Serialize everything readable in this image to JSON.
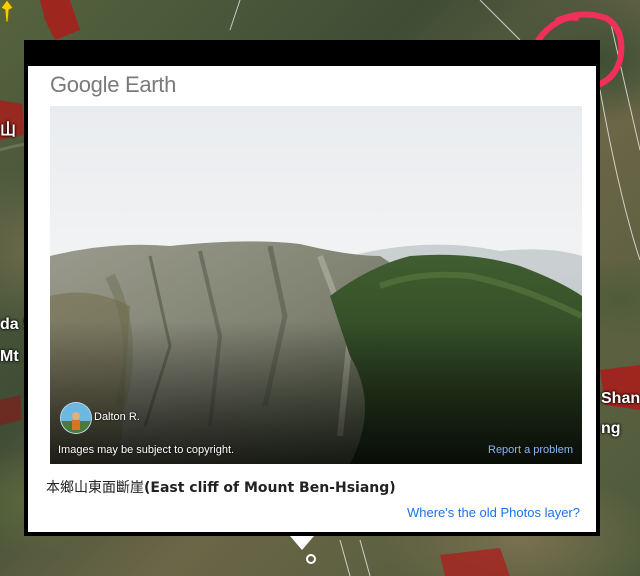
{
  "map": {
    "labels": [
      "山",
      "da S",
      "Mt",
      "Shan",
      "ng"
    ]
  },
  "popup": {
    "logo_text": "Google Earth",
    "author": "Dalton R.",
    "copyright_note": "Images may be subject to copyright.",
    "report_link": "Report a problem",
    "caption_cjk": "本鄉山東面斷崖",
    "caption_en": "(East cliff of Mount Ben-Hsiang)",
    "old_photos_link": "Where's the old Photos layer?"
  },
  "colors": {
    "link_blue": "#1a73e8",
    "report_blue": "#8ab4f8",
    "annotation_red": "#f0305a"
  }
}
